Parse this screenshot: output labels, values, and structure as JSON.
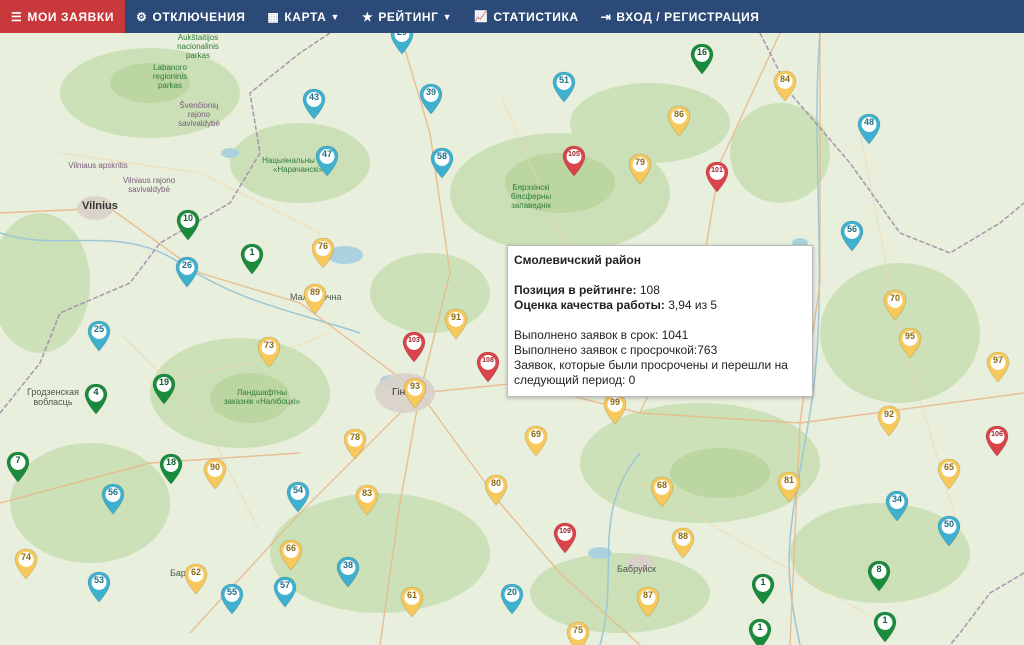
{
  "nav": {
    "items": [
      {
        "key": "my-requests",
        "label": "МОИ ЗАЯВКИ",
        "icon": "list-icon",
        "glyph": "☰",
        "active": true,
        "dropdown": false
      },
      {
        "key": "outages",
        "label": "ОТКЛЮЧЕНИЯ",
        "icon": "gear-icon",
        "glyph": "⚙",
        "active": false,
        "dropdown": false
      },
      {
        "key": "map",
        "label": "КАРТА",
        "icon": "map-icon",
        "glyph": "▦",
        "active": false,
        "dropdown": true
      },
      {
        "key": "rating",
        "label": "РЕЙТИНГ",
        "icon": "star-icon",
        "glyph": "★",
        "active": false,
        "dropdown": true
      },
      {
        "key": "statistics",
        "label": "СТАТИСТИКА",
        "icon": "chart-icon",
        "glyph": "📈",
        "active": false,
        "dropdown": false
      },
      {
        "key": "login",
        "label": "ВХОД / РЕГИСТРАЦИЯ",
        "icon": "sign-in-icon",
        "glyph": "⇥",
        "active": false,
        "dropdown": false
      }
    ]
  },
  "colors": {
    "blue": "#3fb1cf",
    "green": "#1a8a3d",
    "red": "#d9434a",
    "yellow": "#f7c95c"
  },
  "places": {
    "vilnius": "Vilnius",
    "minsk": "Гінск",
    "maladzechna": "Маладзечна",
    "babruysk": "Бабруйск",
    "barysaw": "Бар...",
    "grodno": "Гродзенская вобласць",
    "vilnius_region": "Vilniaus apskritis",
    "aukstaitija": "Aukštaitijos nacionalinis parkas",
    "labanoro": "Labanoro regioninis parkas",
    "svencioniu": "Švenčionių rajono savivaldybė",
    "vilniaus_rajono": "Vilniaus rajono savivaldybė",
    "naroch": "Нацыянальны парк «Нарачанскі»",
    "berezinsky": "Бярэзінскі біясферны запаведнік",
    "naliboki": "Ландшафтны заказнік «Налібоцкі»"
  },
  "markers": [
    {
      "n": "29",
      "c": "blue"
    },
    {
      "n": "16",
      "c": "green"
    },
    {
      "n": "84",
      "c": "yellow"
    },
    {
      "n": "43",
      "c": "blue"
    },
    {
      "n": "39",
      "c": "blue"
    },
    {
      "n": "51",
      "c": "blue"
    },
    {
      "n": "86",
      "c": "yellow"
    },
    {
      "n": "48",
      "c": "blue"
    },
    {
      "n": "47",
      "c": "blue"
    },
    {
      "n": "58",
      "c": "blue"
    },
    {
      "n": "105",
      "c": "red"
    },
    {
      "n": "79",
      "c": "yellow"
    },
    {
      "n": "101",
      "c": "red"
    },
    {
      "n": "10",
      "c": "green"
    },
    {
      "n": "1",
      "c": "green"
    },
    {
      "n": "76",
      "c": "yellow"
    },
    {
      "n": "56",
      "c": "blue"
    },
    {
      "n": "26",
      "c": "blue"
    },
    {
      "n": "89",
      "c": "yellow"
    },
    {
      "n": "70",
      "c": "yellow"
    },
    {
      "n": "91",
      "c": "yellow"
    },
    {
      "n": "25",
      "c": "blue"
    },
    {
      "n": "103",
      "c": "red"
    },
    {
      "n": "73",
      "c": "yellow"
    },
    {
      "n": "108",
      "c": "red"
    },
    {
      "n": "95",
      "c": "yellow"
    },
    {
      "n": "97",
      "c": "yellow"
    },
    {
      "n": "19",
      "c": "green"
    },
    {
      "n": "4",
      "c": "green"
    },
    {
      "n": "93",
      "c": "yellow"
    },
    {
      "n": "99",
      "c": "yellow"
    },
    {
      "n": "92",
      "c": "yellow"
    },
    {
      "n": "78",
      "c": "yellow"
    },
    {
      "n": "69",
      "c": "yellow"
    },
    {
      "n": "106",
      "c": "red"
    },
    {
      "n": "7",
      "c": "green"
    },
    {
      "n": "18",
      "c": "green"
    },
    {
      "n": "90",
      "c": "yellow"
    },
    {
      "n": "65",
      "c": "yellow"
    },
    {
      "n": "56",
      "c": "blue"
    },
    {
      "n": "54",
      "c": "blue"
    },
    {
      "n": "83",
      "c": "yellow"
    },
    {
      "n": "80",
      "c": "yellow"
    },
    {
      "n": "68",
      "c": "yellow"
    },
    {
      "n": "81",
      "c": "yellow"
    },
    {
      "n": "34",
      "c": "blue"
    },
    {
      "n": "50",
      "c": "blue"
    },
    {
      "n": "109",
      "c": "red"
    },
    {
      "n": "88",
      "c": "yellow"
    },
    {
      "n": "66",
      "c": "yellow"
    },
    {
      "n": "74",
      "c": "yellow"
    },
    {
      "n": "62",
      "c": "yellow"
    },
    {
      "n": "38",
      "c": "blue"
    },
    {
      "n": "53",
      "c": "blue"
    },
    {
      "n": "55",
      "c": "blue"
    },
    {
      "n": "57",
      "c": "blue"
    },
    {
      "n": "1",
      "c": "green"
    },
    {
      "n": "8",
      "c": "green"
    },
    {
      "n": "61",
      "c": "yellow"
    },
    {
      "n": "20",
      "c": "blue"
    },
    {
      "n": "87",
      "c": "yellow"
    },
    {
      "n": "1",
      "c": "green"
    },
    {
      "n": "1",
      "c": "green"
    },
    {
      "n": "75",
      "c": "yellow"
    }
  ],
  "tooltip": {
    "title": "Смолевичский район",
    "rating_label": "Позиция в рейтинге:",
    "rating_value": "108",
    "quality_label": "Оценка качества работы:",
    "quality_value": "3,94 из 5",
    "on_time": "Выполнено заявок в срок: 1041",
    "overdue": "Выполнено заявок с просрочкой:763",
    "carried": "Заявок, которые были просрочены и перешли на следующий период: 0"
  }
}
